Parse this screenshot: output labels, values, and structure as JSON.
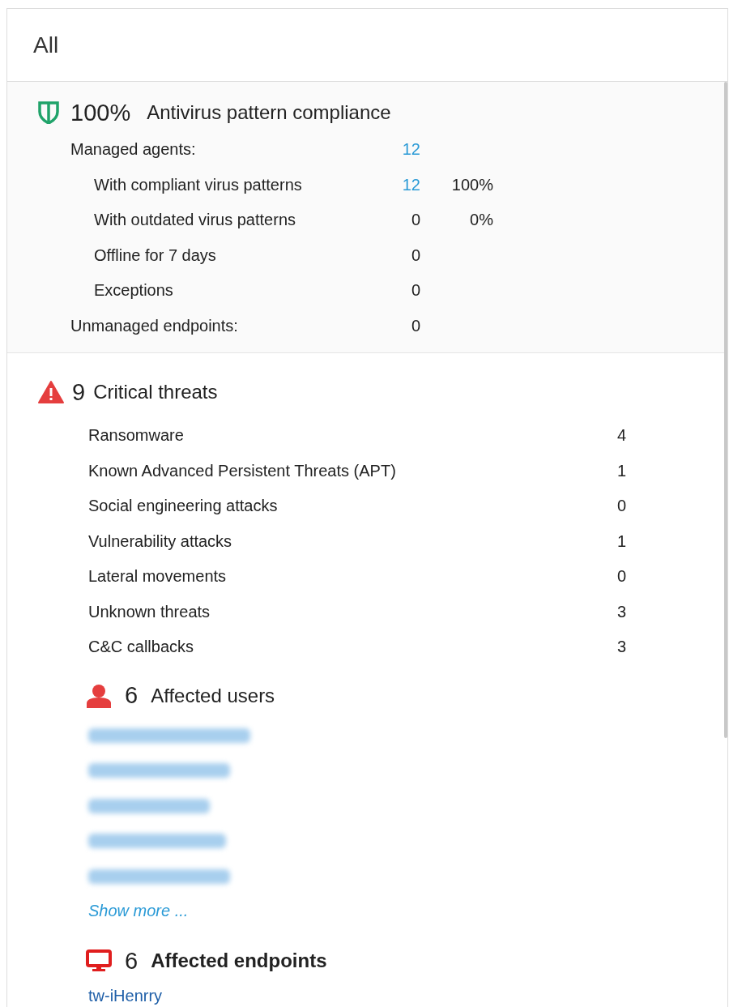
{
  "header": {
    "title": "All"
  },
  "compliance": {
    "percent": "100%",
    "title": "Antivirus pattern compliance",
    "rows": [
      {
        "label": "Managed agents:",
        "indented": false,
        "value": "12",
        "linked": true
      },
      {
        "label": "With compliant virus patterns",
        "indented": true,
        "value": "12",
        "linked": true,
        "percent": "100%"
      },
      {
        "label": "With outdated virus patterns",
        "indented": true,
        "value": "0",
        "linked": false,
        "percent": "0%"
      },
      {
        "label": "Offline for 7 days",
        "indented": true,
        "value": "0",
        "linked": false
      },
      {
        "label": "Exceptions",
        "indented": true,
        "value": "0",
        "linked": false
      },
      {
        "label": "Unmanaged endpoints:",
        "indented": false,
        "value": "0",
        "linked": false
      }
    ]
  },
  "threats": {
    "count": "9",
    "title": "Critical threats",
    "rows": [
      {
        "label": "Ransomware",
        "value": "4"
      },
      {
        "label": "Known Advanced Persistent Threats (APT)",
        "value": "1"
      },
      {
        "label": "Social engineering attacks",
        "value": "0"
      },
      {
        "label": "Vulnerability attacks",
        "value": "1"
      },
      {
        "label": "Lateral movements",
        "value": "0"
      },
      {
        "label": "Unknown threats",
        "value": "3"
      },
      {
        "label": "C&C callbacks",
        "value": "3"
      }
    ]
  },
  "affected_users": {
    "count": "6",
    "title": "Affected users",
    "items": [
      {
        "kind": "redacted"
      },
      {
        "kind": "redacted"
      },
      {
        "kind": "redacted"
      },
      {
        "kind": "redacted"
      },
      {
        "kind": "redacted"
      }
    ],
    "show_more": "Show more ..."
  },
  "affected_endpoints": {
    "count": "6",
    "title": "Affected endpoints",
    "items": [
      {
        "kind": "link",
        "name": "tw-iHenrry"
      }
    ]
  }
}
